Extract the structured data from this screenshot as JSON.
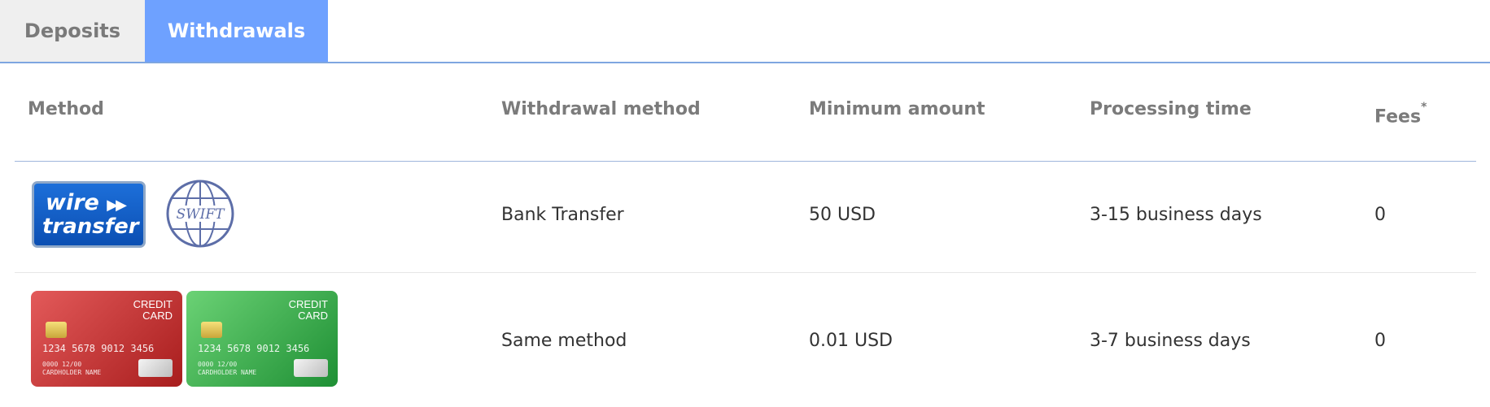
{
  "tabs": [
    {
      "label": "Deposits",
      "active": false
    },
    {
      "label": "Withdrawals",
      "active": true
    }
  ],
  "colors": {
    "active_tab": "#6ea1ff",
    "inactive_tab": "#efefef",
    "header_text": "#7b7b7b",
    "divider": "#9fb5db"
  },
  "table": {
    "headers": {
      "method": "Method",
      "withdrawal_method": "Withdrawal method",
      "minimum_amount": "Minimum amount",
      "processing_time": "Processing time",
      "fees": "Fees",
      "fees_mark": "*"
    },
    "rows": [
      {
        "logos": [
          "wire-transfer-logo",
          "swift-logo"
        ],
        "wire_line1": "wire",
        "wire_arrows": "▶▶",
        "wire_line2": "transfer",
        "swift_text": "SWIFT",
        "withdrawal_method": "Bank Transfer",
        "minimum_amount": "50 USD",
        "processing_time": "3-15 business days",
        "fees": "0"
      },
      {
        "logos": [
          "credit-card-red-logo",
          "credit-card-green-logo"
        ],
        "card_label_1": "CREDIT",
        "card_label_2": "CARD",
        "card_number": "1234 5678 9012 3456",
        "card_small_1": "0000    12/00",
        "card_small_2": "CARDHOLDER NAME",
        "withdrawal_method": "Same method",
        "minimum_amount": "0.01 USD",
        "processing_time": "3-7 business days",
        "fees": "0"
      }
    ]
  }
}
